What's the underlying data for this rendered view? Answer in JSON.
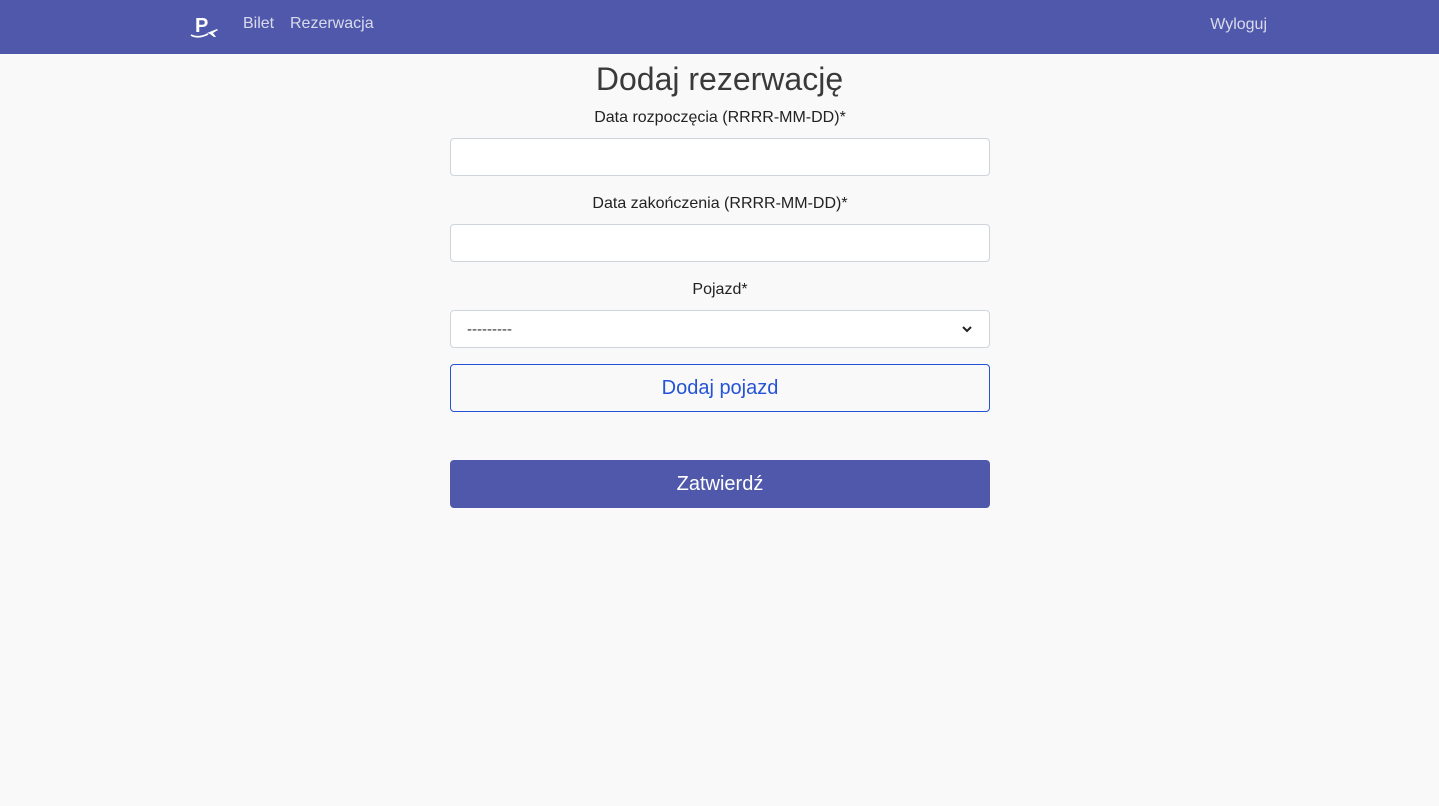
{
  "colors": {
    "navbar_bg": "#4f58aa",
    "page_bg": "#f9f9f9",
    "outline_button": "#2553d6",
    "primary_button": "#4f58aa"
  },
  "navbar": {
    "logo_icon": "parking-plane-logo",
    "links": [
      {
        "label": "Bilet"
      },
      {
        "label": "Rezerwacja"
      }
    ],
    "logout_label": "Wyloguj"
  },
  "form": {
    "title": "Dodaj rezerwację",
    "start_date": {
      "label": "Data rozpoczęcia (RRRR-MM-DD)*",
      "value": "",
      "placeholder": ""
    },
    "end_date": {
      "label": "Data zakończenia (RRRR-MM-DD)*",
      "value": "",
      "placeholder": ""
    },
    "vehicle": {
      "label": "Pojazd*",
      "selected": "---------",
      "icon": "chevron-down-icon"
    },
    "add_vehicle_label": "Dodaj pojazd",
    "submit_label": "Zatwierdź"
  }
}
